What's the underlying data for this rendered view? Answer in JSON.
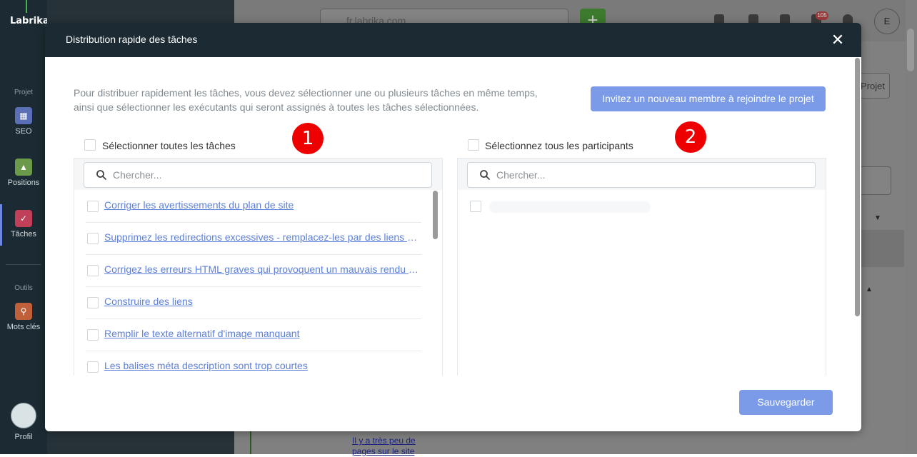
{
  "app": {
    "logo": "Labrika",
    "sidebar": {
      "section_projet": "Projet",
      "section_outils": "Outils",
      "items": [
        {
          "label": "SEO",
          "icon": "seo-icon",
          "color": "#5a6fb6"
        },
        {
          "label": "Positions",
          "icon": "positions-chart-icon",
          "color": "#6a9a4a"
        },
        {
          "label": "Tâches",
          "icon": "tasks-check-icon",
          "color": "#c0405a"
        },
        {
          "label": "Mots clés",
          "icon": "keywords-icon",
          "color": "#c0603a"
        }
      ],
      "profile_label": "Profil"
    },
    "topbar": {
      "url": "fr.labrika.com",
      "notification_count": "105",
      "avatar_letter": "E"
    },
    "background": {
      "projet_button": "Projet",
      "link_text": "Il y a très peu de pages sur le site"
    }
  },
  "modal": {
    "title": "Distribution rapide des tâches",
    "description": "Pour distribuer rapidement les tâches, vous devez sélectionner une ou plusieurs tâches en même temps, ainsi que sélectionner les exécutants qui seront assignés à toutes les tâches sélectionnées.",
    "invite_button": "Invitez un nouveau membre à rejoindre le projet",
    "save_button": "Sauvegarder",
    "accent_color": "#7b9be8",
    "header_color": "#1b2a33",
    "tasks_panel": {
      "marker": "1",
      "select_all_label": "Sélectionner toutes les tâches",
      "search_placeholder": "Chercher...",
      "tasks": [
        "Corriger les avertissements du plan de site",
        "Supprimez les redirections excessives - remplacez-les par des liens directs",
        "Corrigez les erreurs HTML graves qui provoquent un mauvais rendu de la page",
        "Construire des liens",
        "Remplir le texte alternatif d'image manquant",
        "Les balises méta description sont trop courtes"
      ]
    },
    "participants_panel": {
      "marker": "2",
      "select_all_label": "Sélectionnez tous les participants",
      "search_placeholder": "Chercher..."
    }
  }
}
